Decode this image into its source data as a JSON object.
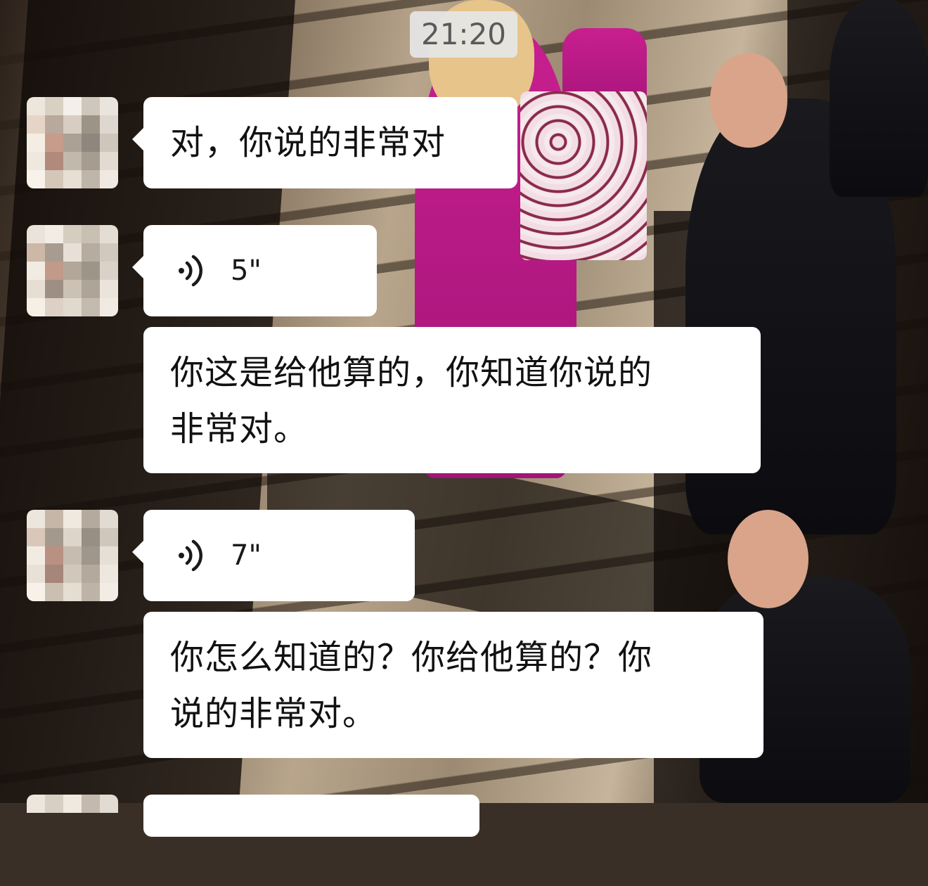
{
  "chat": {
    "timestamp": "21:20",
    "messages": [
      {
        "type": "text",
        "text": "对，你说的非常对"
      },
      {
        "type": "voice",
        "icon": "voice-wave-icon",
        "duration": "5\""
      },
      {
        "type": "text",
        "text": "你这是给他算的，你知道你说的\n非常对。"
      },
      {
        "type": "voice",
        "icon": "voice-wave-icon",
        "duration": "7\""
      },
      {
        "type": "text",
        "text": "你怎么知道的？你给他算的？你\n说的非常对。"
      }
    ]
  },
  "colors": {
    "bubble_bg": "#ffffff",
    "timestamp_bg": "#e6e6e6",
    "timestamp_text": "#5a5a5a",
    "message_text": "#111111"
  }
}
